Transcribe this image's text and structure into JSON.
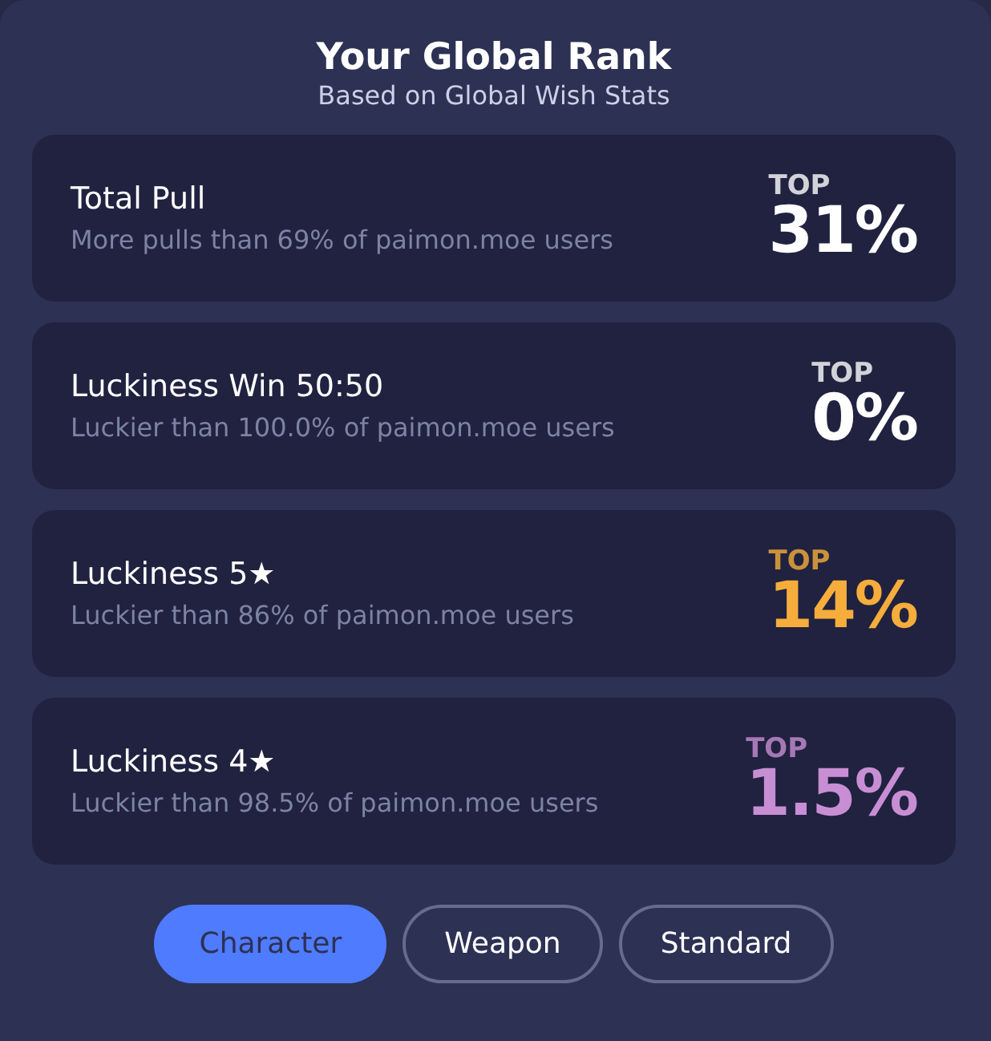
{
  "header": {
    "title": "Your Global Rank",
    "subtitle": "Based on Global Wish Stats"
  },
  "stats": [
    {
      "title": "Total Pull",
      "description": "More pulls than 69% of paimon.moe users",
      "rank_label": "TOP",
      "rank": "31%",
      "color": "#ffffff"
    },
    {
      "title": "Luckiness Win 50:50",
      "description": "Luckier than 100.0% of paimon.moe users",
      "rank_label": "TOP",
      "rank": "0%",
      "color": "#ffffff"
    },
    {
      "title": "Luckiness 5★",
      "description": "Luckier than 86% of paimon.moe users",
      "rank_label": "TOP",
      "rank": "14%",
      "color": "#f6ad3b"
    },
    {
      "title": "Luckiness 4★",
      "description": "Luckier than 98.5% of paimon.moe users",
      "rank_label": "TOP",
      "rank": "1.5%",
      "color": "#c88ed4"
    }
  ],
  "tabs": [
    {
      "label": "Character",
      "selected": true
    },
    {
      "label": "Weapon",
      "selected": false
    },
    {
      "label": "Standard",
      "selected": false
    }
  ]
}
